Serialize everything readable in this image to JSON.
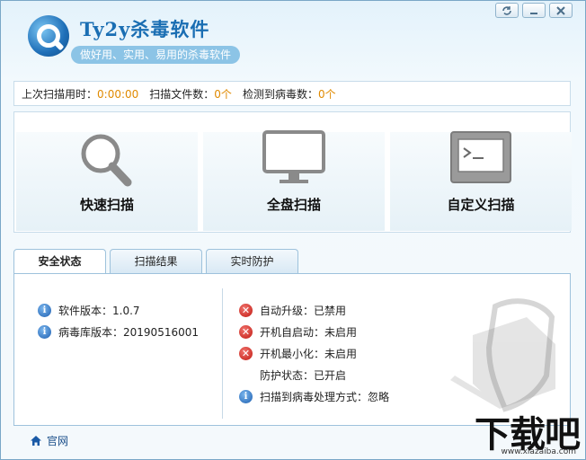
{
  "header": {
    "title": "Ty2y杀毒软件",
    "slogan": "做好用、实用、易用的杀毒软件"
  },
  "window_buttons": [
    "restore-icon",
    "minimize-icon",
    "close-icon"
  ],
  "stats": {
    "last_scan_label": "上次扫描用时：",
    "last_scan_value": "0:00:00",
    "files_label": "扫描文件数：",
    "files_value": "0个",
    "virus_label": "检测到病毒数：",
    "virus_value": "0个"
  },
  "scan": {
    "quick": "快速扫描",
    "full": "全盘扫描",
    "custom": "自定义扫描"
  },
  "tabs": [
    "安全状态",
    "扫描结果",
    "实时防护"
  ],
  "status": {
    "left": [
      {
        "label": "软件版本：",
        "value": "1.0.7",
        "icon": "info"
      },
      {
        "label": "病毒库版本：",
        "value": "20190516001",
        "icon": "info"
      }
    ],
    "right": [
      {
        "label": "自动升级：",
        "value": "已禁用",
        "icon": "error"
      },
      {
        "label": "开机自启动：",
        "value": "未启用",
        "icon": "error"
      },
      {
        "label": "开机最小化：",
        "value": "未启用",
        "icon": "error"
      },
      {
        "label": "防护状态：",
        "value": "已开启",
        "icon": "none"
      },
      {
        "label": "扫描到病毒处理方式：",
        "value": "忽略",
        "icon": "info"
      }
    ]
  },
  "footer": {
    "website": "官网"
  },
  "watermark": {
    "main": "下载吧",
    "sub": "www.xiazaiba.com"
  },
  "colors": {
    "accent": "#1a6eb3",
    "value": "#e08a00",
    "error": "#c01810",
    "info": "#1e5fb0"
  }
}
